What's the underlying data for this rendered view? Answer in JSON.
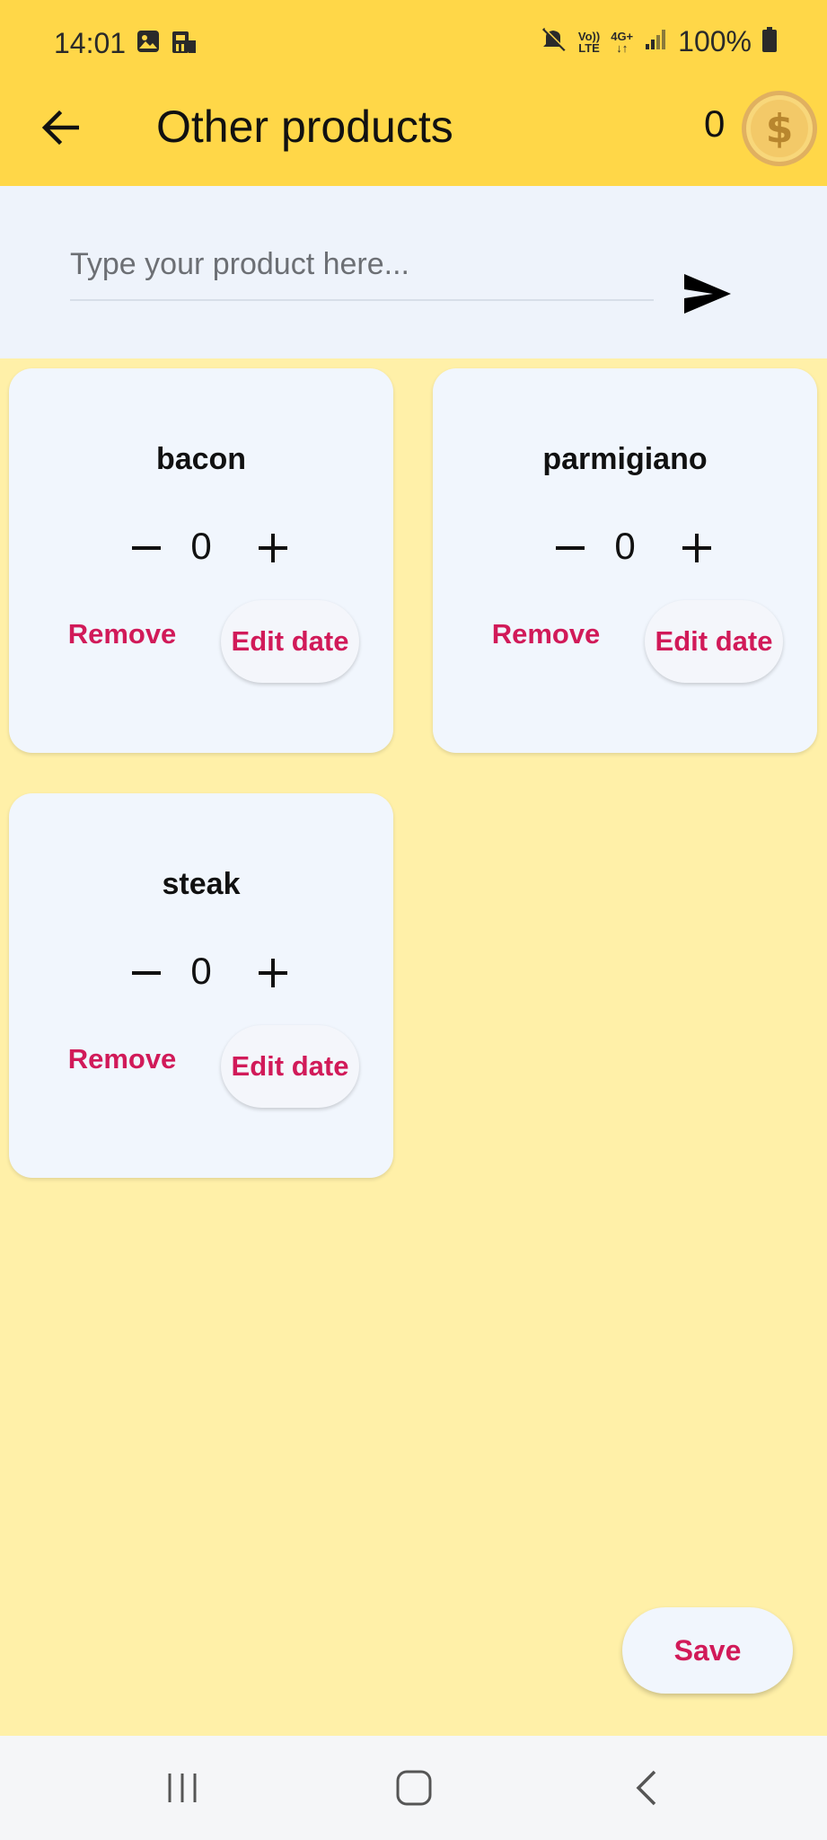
{
  "status_bar": {
    "time": "14:01",
    "left_icons": [
      "image-icon",
      "sim-transfer-icon"
    ],
    "right_icons": [
      "mute-icon",
      "volte-icon",
      "4g-icon",
      "signal-icon",
      "battery-icon"
    ],
    "volte_label": "Vo))\nLTE",
    "network_label": "4G+",
    "battery": "100%"
  },
  "app_bar": {
    "title": "Other products",
    "coin_count": "0",
    "coin_symbol": "$"
  },
  "input": {
    "placeholder": "Type your product here...",
    "value": ""
  },
  "products": [
    {
      "name": "bacon",
      "quantity": "0",
      "remove_label": "Remove",
      "edit_label": "Edit date"
    },
    {
      "name": "parmigiano",
      "quantity": "0",
      "remove_label": "Remove",
      "edit_label": "Edit date"
    },
    {
      "name": "steak",
      "quantity": "0",
      "remove_label": "Remove",
      "edit_label": "Edit date"
    }
  ],
  "stepper": {
    "minus": "−",
    "plus": "+"
  },
  "save_label": "Save",
  "nav": [
    "recent-apps-icon",
    "home-icon",
    "back-nav-icon"
  ],
  "colors": {
    "app_bar": "#ffd748",
    "background": "#fff0a8",
    "card": "#f1f6fd",
    "accent": "#d11a59",
    "input_area": "#eef3fb"
  }
}
